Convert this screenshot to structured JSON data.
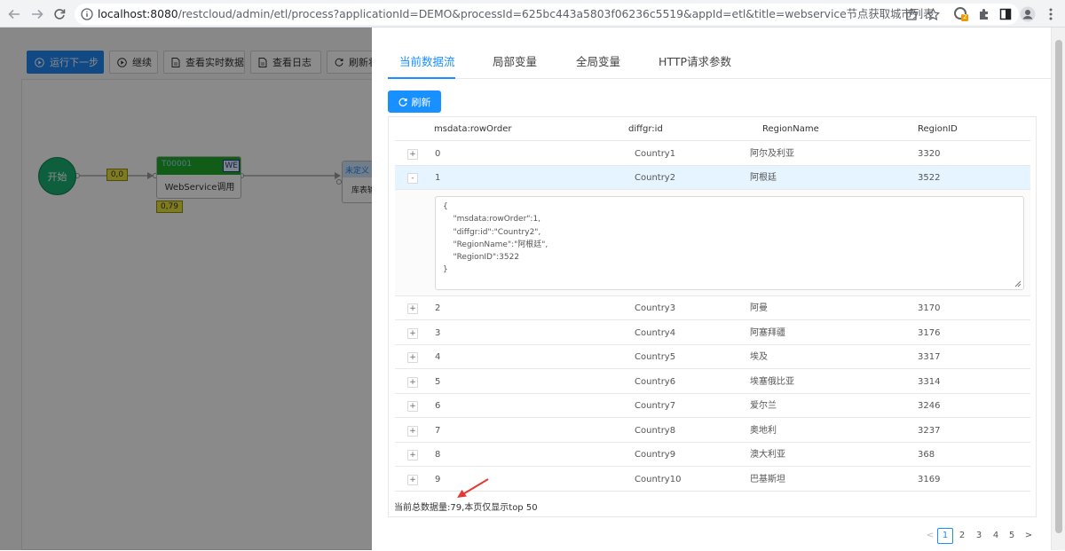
{
  "browser": {
    "url_host": "localhost:8080",
    "url_rest": "/restcloud/admin/etl/process?applicationId=DEMO&processId=625bc443a5803f06236c5519&appId=etl&title=webservice节点获取城市列表",
    "extension_badge": "2"
  },
  "toolbar": {
    "run_next_step": "运行下一步",
    "continue": "继续",
    "view_realtime_data": "查看实时数据",
    "view_log": "查看日志",
    "refresh_status": "刷新状"
  },
  "flow": {
    "start_label": "开始",
    "edge1_label": "0,0",
    "ws_header": "T00001",
    "ws_badge": "WE",
    "ws_label": "WebService调用",
    "ws_count": "0,79",
    "undefined_header": "未定义",
    "undefined_label": "库表输"
  },
  "drawer": {
    "tabs": [
      "当前数据流",
      "局部变量",
      "全局变量",
      "HTTP请求参数"
    ],
    "active_tab": 0,
    "refresh_label": "刷新",
    "columns": [
      "msdata:rowOrder",
      "diffgr:id",
      "RegionName",
      "RegionID"
    ],
    "rows": [
      {
        "order": "0",
        "id": "Country1",
        "name": "阿尔及利亚",
        "region_id": "3320",
        "expanded": false
      },
      {
        "order": "1",
        "id": "Country2",
        "name": "阿根廷",
        "region_id": "3522",
        "expanded": true
      },
      {
        "order": "2",
        "id": "Country3",
        "name": "阿曼",
        "region_id": "3170",
        "expanded": false
      },
      {
        "order": "3",
        "id": "Country4",
        "name": "阿塞拜疆",
        "region_id": "3176",
        "expanded": false
      },
      {
        "order": "4",
        "id": "Country5",
        "name": "埃及",
        "region_id": "3317",
        "expanded": false
      },
      {
        "order": "5",
        "id": "Country6",
        "name": "埃塞俄比亚",
        "region_id": "3314",
        "expanded": false
      },
      {
        "order": "6",
        "id": "Country7",
        "name": "爱尔兰",
        "region_id": "3246",
        "expanded": false
      },
      {
        "order": "7",
        "id": "Country8",
        "name": "奥地利",
        "region_id": "3237",
        "expanded": false
      },
      {
        "order": "8",
        "id": "Country9",
        "name": "澳大利亚",
        "region_id": "368",
        "expanded": false
      },
      {
        "order": "9",
        "id": "Country10",
        "name": "巴基斯坦",
        "region_id": "3169",
        "expanded": false
      }
    ],
    "expanded_json": "{\n    \"msdata:rowOrder\":1,\n    \"diffgr:id\":\"Country2\",\n    \"RegionName\":\"阿根廷\",\n    \"RegionID\":3522\n}",
    "footer_text": "当前总数据量:79,本页仅显示top 50",
    "pagination": {
      "pages": [
        "1",
        "2",
        "3",
        "4",
        "5"
      ],
      "current": "1"
    }
  },
  "colors": {
    "accent": "#1890ff",
    "annotation_arrow": "#e53935",
    "start_node": "#1aae6f",
    "ws_header": "#1faa2c"
  }
}
